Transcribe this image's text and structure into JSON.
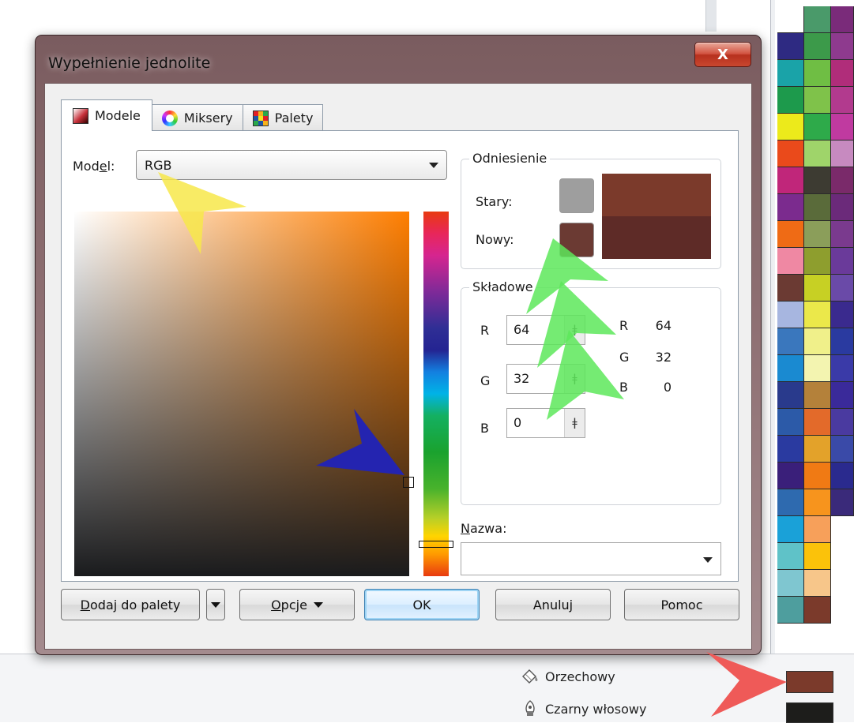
{
  "dialog": {
    "title": "Wypełnienie jednolite",
    "close_label": "X"
  },
  "tabs": [
    {
      "label": "Modele",
      "icon": "color-models-icon",
      "active": true
    },
    {
      "label": "Miksery",
      "icon": "color-wheel-icon",
      "active": false
    },
    {
      "label": "Palety",
      "icon": "palette-grid-icon",
      "active": false
    }
  ],
  "model": {
    "label_pre": "Mod",
    "label_accel": "e",
    "label_post": "l:",
    "value": "RGB"
  },
  "reference": {
    "title": "Odniesienie",
    "old_label": "Stary:",
    "new_label": "Nowy:",
    "old_color": "#9e9e9e",
    "new_color": "#6b3a33",
    "old_large_color": "#7b3a2b",
    "new_large_color": "#5e2b27"
  },
  "components": {
    "title": "Składowe",
    "inputs": [
      {
        "label": "R",
        "value": "64"
      },
      {
        "label": "G",
        "value": "32"
      },
      {
        "label": "B",
        "value": "0"
      }
    ],
    "outputs": [
      {
        "label": "R",
        "value": "64"
      },
      {
        "label": "G",
        "value": "32"
      },
      {
        "label": "B",
        "value": "0"
      }
    ]
  },
  "name": {
    "label_accel": "N",
    "label_rest": "azwa:",
    "value": ""
  },
  "buttons": {
    "add_accel": "D",
    "add_rest": "odaj do palety",
    "options_accel": "O",
    "options_rest": "pcje",
    "ok": "OK",
    "cancel": "Anuluj",
    "help": "Pomoc"
  },
  "status": {
    "fill_name": "Orzechowy",
    "outline_name": "Czarny włosowy",
    "fill_color": "#7b3a2b",
    "outline_color": "#1d1d1b",
    "fill_icon": "paint-bucket-icon",
    "outline_icon": "pen-nib-icon"
  },
  "accent_colors": {
    "annotation_yellow": "#f7e84a",
    "annotation_green": "#5de85a",
    "annotation_blue": "#2424b0",
    "annotation_red": "#ef5a58"
  },
  "palette_colors": {
    "col1": [
      "#ffffff",
      "#2e2a82",
      "#1aa3a8",
      "#1d9a4c",
      "#ecea1b",
      "#ea4a1b",
      "#c0267a",
      "#7b2b8e",
      "#ef6b15",
      "#ef88a3",
      "#6b3a33",
      "#a7b6e0",
      "#3a77bd",
      "#1a8ad1",
      "#293a8c",
      "#2c5aa8",
      "#2a3aa0",
      "#3a1f7a",
      "#2e6aaf",
      "#1aa1d8",
      "#5fc2c8",
      "#7fc6d0",
      "#4e9e9e"
    ],
    "col2": [
      "#4a9a6a",
      "#3c9a4a",
      "#6fbe44",
      "#7fc24a",
      "#2eaa4a",
      "#9fd46a",
      "#3d3b32",
      "#5a6b3a",
      "#8b9e5a",
      "#8e9e2e",
      "#c7d024",
      "#ebe84a",
      "#f0f08a",
      "#f3f4b0",
      "#b4813a",
      "#e36a2a",
      "#e3a22a",
      "#f07a14",
      "#f7941d",
      "#f7a05a",
      "#fbc20a",
      "#f7c68a",
      "#7b3a2b"
    ],
    "col3": [
      "#7a2b7a",
      "#8e3a8e",
      "#b02d7a",
      "#b23a8e",
      "#c03aa0",
      "#c78ac0",
      "#7a2a6a",
      "#6b2a7a",
      "#7a3a8e",
      "#6a3a9a",
      "#6a4aa8",
      "#3a2a8e",
      "#2a3aa0",
      "#3a3aa8",
      "#3a2a9a",
      "#4a3aa0",
      "#3a4aa8",
      "#2a2a8e",
      "#3a2a7a"
    ]
  }
}
